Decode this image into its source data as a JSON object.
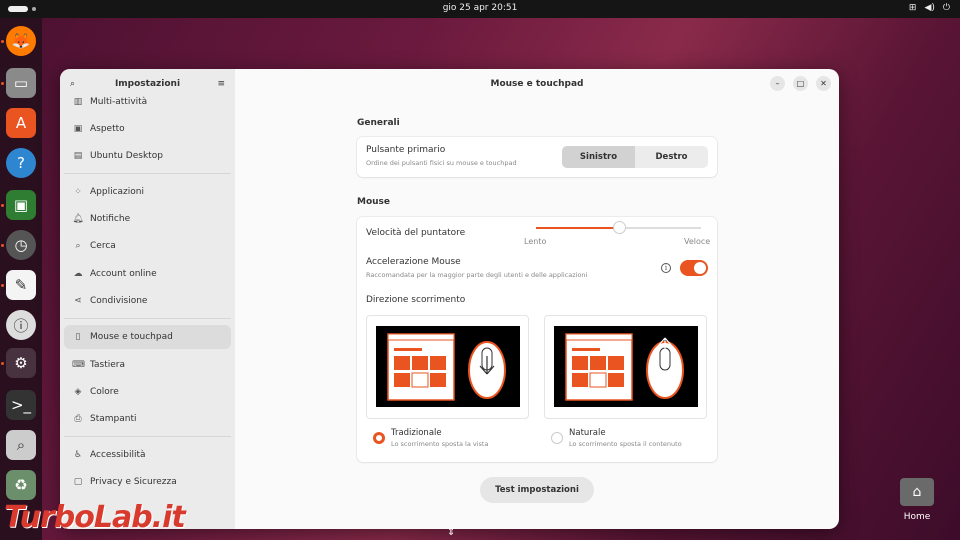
{
  "topbar": {
    "clock": "gio 25 apr  20:51",
    "icons": [
      "network-icon",
      "volume-icon",
      "power-icon"
    ]
  },
  "dock": {
    "apps": [
      {
        "name": "firefox",
        "icon": "firefox-icon"
      },
      {
        "name": "files",
        "icon": "files-icon"
      },
      {
        "name": "app-center",
        "icon": "app-center-icon"
      },
      {
        "name": "help",
        "icon": "help-icon"
      },
      {
        "name": "system-monitor",
        "icon": "chip-icon"
      },
      {
        "name": "clocks",
        "icon": "clock-icon"
      },
      {
        "name": "text-editor",
        "icon": "text-editor-icon"
      },
      {
        "name": "password",
        "icon": "password-icon"
      },
      {
        "name": "settings",
        "icon": "settings-icon"
      },
      {
        "name": "terminal",
        "icon": "terminal-icon"
      },
      {
        "name": "search-tool",
        "icon": "magnifier-icon"
      },
      {
        "name": "trash",
        "icon": "trash-icon"
      }
    ]
  },
  "sidebar": {
    "title": "Impostazioni",
    "items": [
      {
        "label": "Multi-attività",
        "icon": "multitask-icon"
      },
      {
        "label": "Aspetto",
        "icon": "appearance-icon"
      },
      {
        "label": "Ubuntu Desktop",
        "icon": "desktop-icon"
      },
      {
        "label": "Applicazioni",
        "icon": "apps-grid-icon"
      },
      {
        "label": "Notifiche",
        "icon": "bell-icon"
      },
      {
        "label": "Cerca",
        "icon": "search-icon"
      },
      {
        "label": "Account online",
        "icon": "cloud-icon"
      },
      {
        "label": "Condivisione",
        "icon": "share-icon"
      },
      {
        "label": "Mouse e touchpad",
        "icon": "mouse-icon"
      },
      {
        "label": "Tastiera",
        "icon": "keyboard-icon"
      },
      {
        "label": "Colore",
        "icon": "color-icon"
      },
      {
        "label": "Stampanti",
        "icon": "printer-icon"
      },
      {
        "label": "Accessibilità",
        "icon": "accessibility-icon"
      },
      {
        "label": "Privacy e Sicurezza",
        "icon": "lock-icon"
      }
    ],
    "selected": "Mouse e touchpad"
  },
  "main": {
    "title": "Mouse e touchpad",
    "window_controls": [
      "minimize-icon",
      "maximize-icon",
      "close-icon"
    ],
    "generali": {
      "title": "Generali",
      "primary_button": {
        "label": "Pulsante primario",
        "sub": "Ordine dei pulsanti fisici su mouse e touchpad",
        "options": [
          "Sinistro",
          "Destro"
        ],
        "selected": "Sinistro"
      }
    },
    "mouse": {
      "title": "Mouse",
      "speed": {
        "label": "Velocità del puntatore",
        "min_label": "Lento",
        "max_label": "Veloce",
        "value": 0.5
      },
      "acceleration": {
        "label": "Accelerazione Mouse",
        "sub": "Raccomandata per la maggior parte degli utenti e delle applicazioni",
        "enabled": true,
        "info_glyph": "i"
      },
      "scroll": {
        "label": "Direzione scorrimento",
        "options": [
          {
            "label": "Tradizionale",
            "sub": "Lo scorrimento sposta la vista",
            "selected": true
          },
          {
            "label": "Naturale",
            "sub": "Lo scorrimento sposta il contenuto",
            "selected": false
          }
        ]
      }
    },
    "test_button": "Test impostazioni"
  },
  "desktop": {
    "home_label": "Home"
  },
  "watermark": "TurboLab.it",
  "colors": {
    "accent": "#e95420",
    "window_bg": "#fafafa",
    "sidebar_bg": "#ebebeb"
  }
}
